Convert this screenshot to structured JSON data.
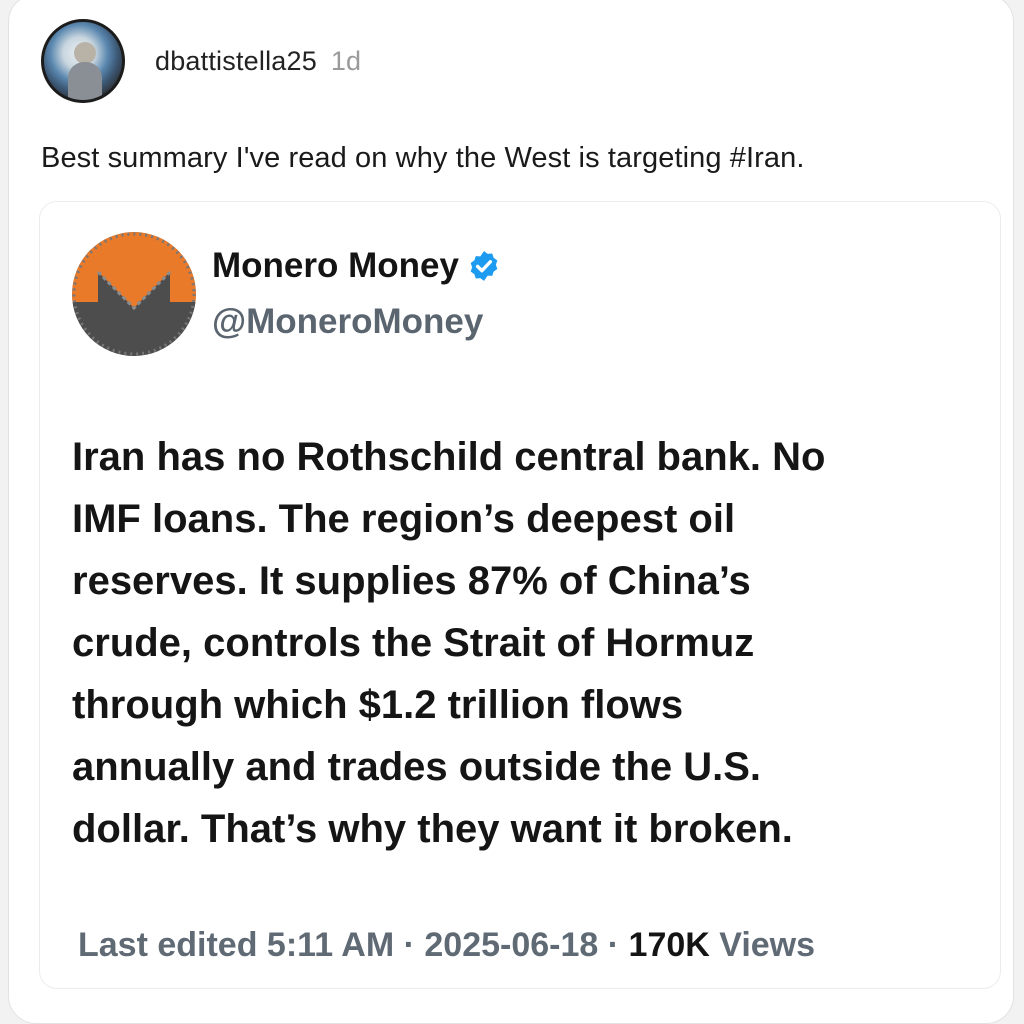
{
  "post": {
    "username": "dbattistella25",
    "time": "1d",
    "text": "Best summary I've read on why the West is targeting #Iran."
  },
  "quoted": {
    "name": "Monero Money",
    "handle": "@MoneroMoney",
    "verified": true,
    "verified_color": "#1d9bf0",
    "body_lines": [
      "Iran has no Rothschild central bank. No",
      "IMF loans. The region’s deepest oil",
      "reserves. It supplies 87% of China’s",
      "crude, controls the Strait of Hormuz",
      "through which $1.2 trillion flows",
      "annually and trades outside the U.S.",
      "dollar. That’s why they want it broken."
    ],
    "footer": {
      "edited_label": "Last edited 5:11 AM",
      "sep1": " · ",
      "date": "2025-06-18",
      "sep2": " · ",
      "views_count": "170K",
      "views_label": " Views"
    }
  },
  "colors": {
    "monero_orange": "#e87a2a",
    "monero_gray": "#4d4d4d"
  }
}
